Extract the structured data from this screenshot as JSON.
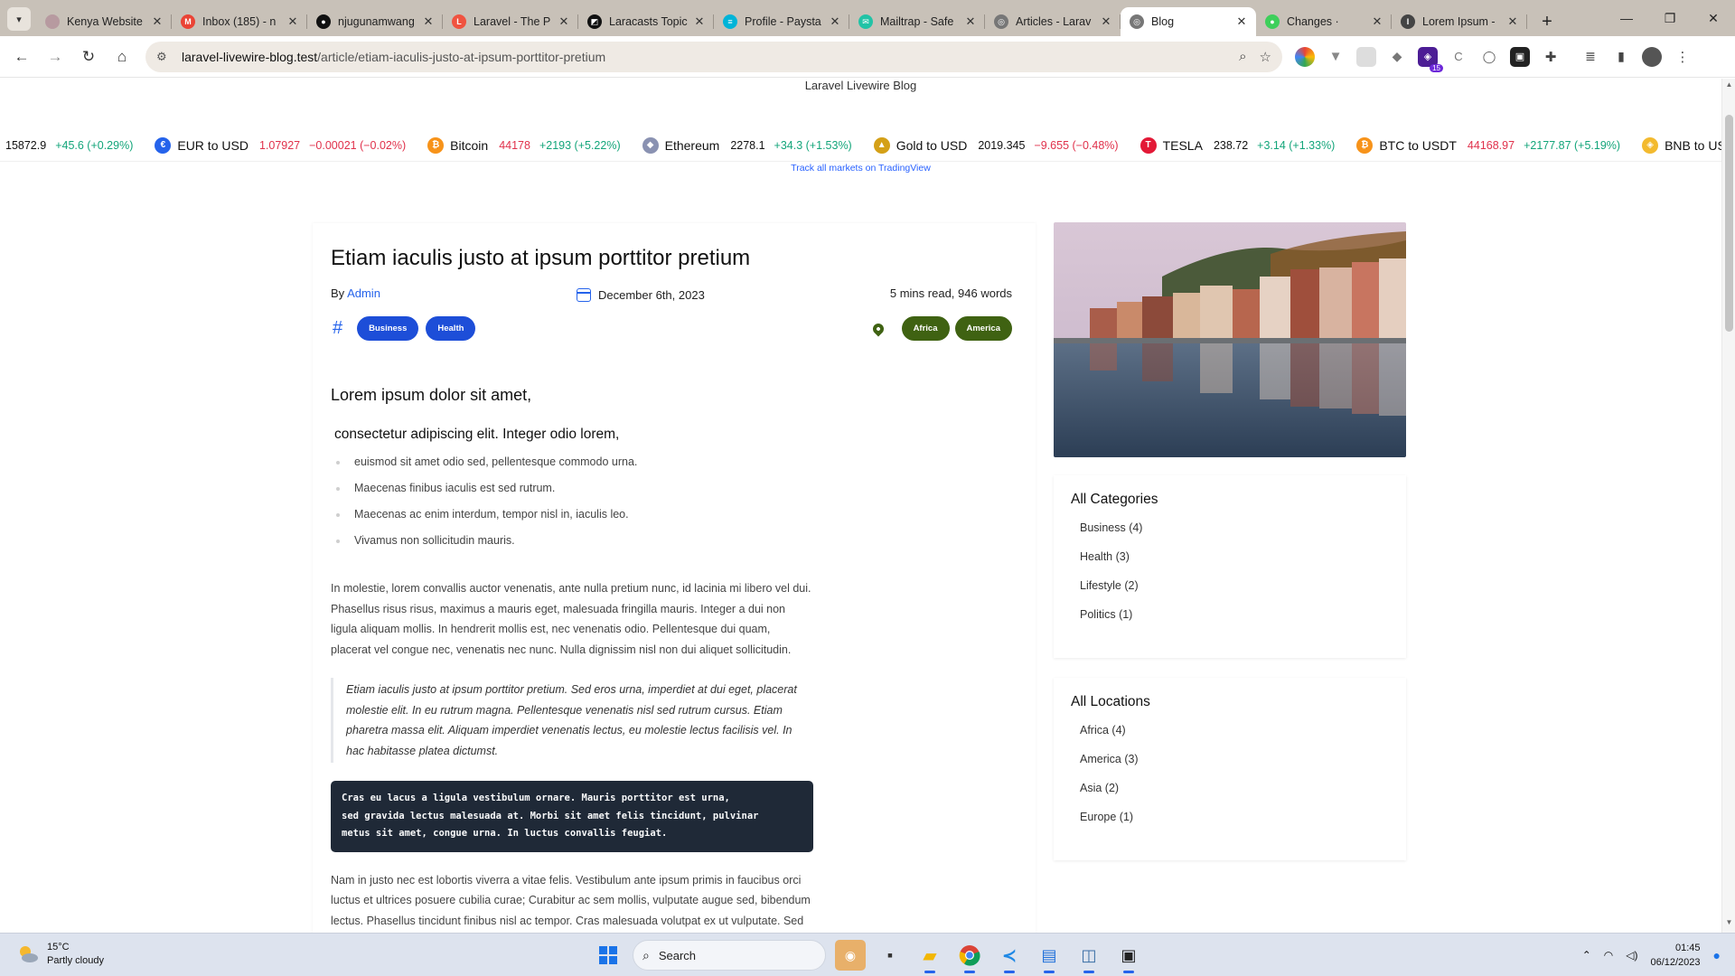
{
  "browser": {
    "tabs": [
      {
        "title": "Kenya Website",
        "fav_color": "#b79aa0",
        "fav_glyph": ""
      },
      {
        "title": "Inbox (185) - n",
        "fav_color": "#ea4335",
        "fav_glyph": "M"
      },
      {
        "title": "njugunamwang",
        "fav_color": "#111111",
        "fav_glyph": "●"
      },
      {
        "title": "Laravel - The P",
        "fav_color": "#f05340",
        "fav_glyph": "L"
      },
      {
        "title": "Laracasts Topic",
        "fav_color": "#111111",
        "fav_glyph": "◩"
      },
      {
        "title": "Profile - Paysta",
        "fav_color": "#00b4d8",
        "fav_glyph": "≡"
      },
      {
        "title": "Mailtrap - Safe",
        "fav_color": "#22c3a6",
        "fav_glyph": "✉"
      },
      {
        "title": "Articles - Larav",
        "fav_color": "#777777",
        "fav_glyph": "◎"
      },
      {
        "title": "Blog",
        "fav_color": "#777777",
        "fav_glyph": "◎",
        "active": true
      },
      {
        "title": "Changes ·",
        "fav_color": "#3ecf5b",
        "fav_glyph": "●"
      },
      {
        "title": "Lorem Ipsum -",
        "fav_color": "#444444",
        "fav_glyph": "I"
      }
    ],
    "url_host": "laravel-livewire-blog.test",
    "url_path": "/article/etiam-iaculis-justo-at-ipsum-porttitor-pretium",
    "extension_badge": "15"
  },
  "page": {
    "brand": "Laravel Livewire Blog",
    "ticker": [
      {
        "name": "",
        "price": "15872.9",
        "price_red": false,
        "change": "+45.6 (+0.29%)",
        "dir": "up",
        "icon_color": "",
        "icon": ""
      },
      {
        "name": "EUR to USD",
        "price": "1.07927",
        "price_red": true,
        "change": "−0.00021 (−0.02%)",
        "dir": "down",
        "icon_color": "#2563eb",
        "icon": "€"
      },
      {
        "name": "Bitcoin",
        "price": "44178",
        "price_red": true,
        "change": "+2193 (+5.22%)",
        "dir": "up",
        "icon_color": "#f7931a",
        "icon": "₿"
      },
      {
        "name": "Ethereum",
        "price": "2278.1",
        "price_red": false,
        "change": "+34.3 (+1.53%)",
        "dir": "up",
        "icon_color": "#8a92b2",
        "icon": "◆"
      },
      {
        "name": "Gold to USD",
        "price": "2019.345",
        "price_red": false,
        "change": "−9.655 (−0.48%)",
        "dir": "down",
        "icon_color": "#d4a017",
        "icon": "▲"
      },
      {
        "name": "TESLA",
        "price": "238.72",
        "price_red": false,
        "change": "+3.14 (+1.33%)",
        "dir": "up",
        "icon_color": "#e31937",
        "icon": "T"
      },
      {
        "name": "BTC to USDT",
        "price": "44168.97",
        "price_red": true,
        "change": "+2177.87 (+5.19%)",
        "dir": "up",
        "icon_color": "#f7931a",
        "icon": "₿"
      },
      {
        "name": "BNB to USDT",
        "price": "",
        "price_red": false,
        "change": "",
        "dir": "up",
        "icon_color": "#f3ba2f",
        "icon": "◈"
      }
    ],
    "track_link": "Track all markets on TradingView",
    "article": {
      "title": "Etiam iaculis justo at ipsum porttitor pretium",
      "by_label": "By",
      "author": "Admin",
      "date": "December 6th, 2023",
      "read_info": "5 mins read, 946 words",
      "categories": [
        "Business",
        "Health"
      ],
      "locations": [
        "Africa",
        "America"
      ],
      "h2": "Lorem ipsum dolor sit amet,",
      "h3": "consectetur adipiscing elit. Integer odio lorem,",
      "list": [
        "euismod sit amet odio sed, pellentesque commodo urna.",
        "Maecenas finibus iaculis est sed rutrum.",
        "Maecenas ac enim interdum, tempor nisl in, iaculis leo.",
        "Vivamus non sollicitudin mauris."
      ],
      "para1": "In molestie, lorem convallis auctor venenatis, ante nulla pretium nunc, id lacinia mi libero vel dui. Phasellus risus risus, maximus a mauris eget, malesuada fringilla mauris. Integer a dui non ligula aliquam mollis. In hendrerit mollis est, nec venenatis odio. Pellentesque dui quam, placerat vel congue nec, venenatis nec nunc. Nulla dignissim nisl non dui aliquet sollicitudin.",
      "quote": "Etiam iaculis justo at ipsum porttitor pretium. Sed eros urna, imperdiet at dui eget, placerat molestie elit. In eu rutrum magna. Pellentesque venenatis nisl sed rutrum cursus. Etiam pharetra massa elit. Aliquam imperdiet venenatis lectus, eu molestie lectus facilisis vel. In hac habitasse platea dictumst.",
      "code": "Cras eu lacus a ligula vestibulum ornare. Mauris porttitor est urna,\nsed gravida lectus malesuada at. Morbi sit amet felis tincidunt, pulvinar\nmetus sit amet, congue urna. In luctus convallis feugiat.",
      "para2": "Nam in justo nec est lobortis viverra a vitae felis. Vestibulum ante ipsum primis in faucibus orci luctus et ultrices posuere cubilia curae; Curabitur ac sem mollis, vulputate augue sed, bibendum lectus. Phasellus tincidunt finibus nisl ac tempor. Cras malesuada volutpat ex ut vulputate. Sed blandit pretium felis, at ultricies nulla malesuada volutpat. Sed nisi erat, aliquet"
    },
    "sidebar": {
      "categories_title": "All Categories",
      "categories": [
        "Business (4)",
        "Health (3)",
        "Lifestyle (2)",
        "Politics (1)"
      ],
      "locations_title": "All Locations",
      "locations": [
        "Africa (4)",
        "America (3)",
        "Asia (2)",
        "Europe (1)"
      ]
    }
  },
  "taskbar": {
    "temp": "15°C",
    "weather": "Partly cloudy",
    "search_placeholder": "Search",
    "time": "01:45",
    "date": "06/12/2023"
  },
  "colors": {
    "accent_blue": "#1d4ed8",
    "location_green": "#3f6212",
    "code_bg": "#1f2937",
    "ticker_up": "#13a57a",
    "ticker_down": "#e0314b"
  }
}
